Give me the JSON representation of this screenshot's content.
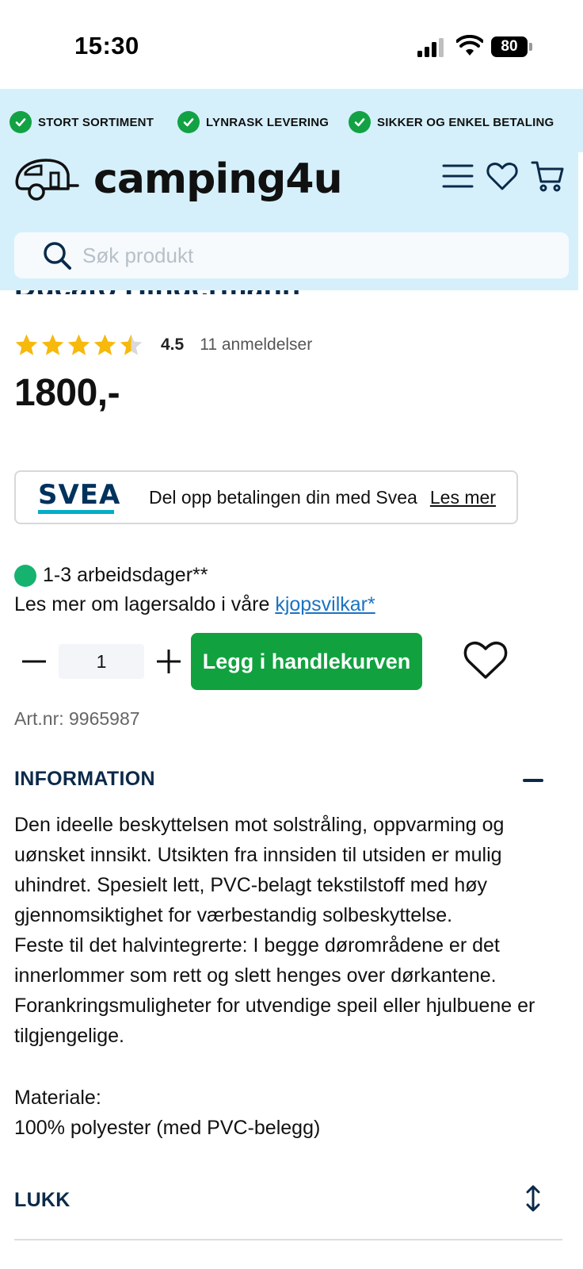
{
  "status_bar": {
    "time": "15:30",
    "battery": "80"
  },
  "usp": [
    {
      "label": "STORT SORTIMENT"
    },
    {
      "label": "LYNRASK LEVERING"
    },
    {
      "label": "SIKKER OG ENKEL BETALING"
    }
  ],
  "header": {
    "logo_text": "camping4u",
    "search_placeholder": "Søk produkt"
  },
  "product": {
    "title": "Ducato Hindermann",
    "rating_value": "4.5",
    "rating_count": "11 anmeldelser",
    "rating_stars": 4.5,
    "price": "1800,-",
    "svea_logo": "SVEA",
    "svea_text": "Del opp betalingen din med Svea",
    "svea_link": "Les mer",
    "stock_text": "1-3 arbeidsdager**",
    "terms_text": "Les mer om lagersaldo i våre ",
    "terms_link": "kjopsvilkar*",
    "quantity": "1",
    "add_to_cart": "Legg i handlekurven",
    "art_nr": "Art.nr: 9965987"
  },
  "information": {
    "heading": "INFORMATION",
    "paragraphs": [
      "Den ideelle beskyttelsen mot solstråling, oppvarming og uønsket innsikt. Utsikten fra innsiden til utsiden er mulig uhindret. Spesielt lett, PVC-belagt tekstilstoff med høy gjennomsiktighet for værbestandig solbeskyttelse.",
      "Feste til det halvintegrerte: I begge dørområdene er det innerlommer som rett og slett henges over dørkantene. Forankringsmuligheter for utvendige speil eller hjulbuene er tilgjengelige."
    ],
    "material_label": "Materiale:",
    "material_value": "100% polyester (med PVC-belegg)"
  },
  "lukk": {
    "label": "LUKK"
  },
  "colors": {
    "header_bg": "#d5f0fb",
    "check_green": "#12a244",
    "cart_green": "#11a23f",
    "navy": "#0b2a4a",
    "link_blue": "#1b73c2",
    "star_gold": "#f6b90c",
    "stock_green": "#16b370"
  },
  "icons": [
    "signal-icon",
    "wifi-icon",
    "battery-icon",
    "check-icon",
    "caravan-logo-icon",
    "menu-icon",
    "heart-icon",
    "cart-icon",
    "search-icon",
    "minus-icon",
    "plus-icon",
    "collapse-icon",
    "sort-arrows-icon"
  ]
}
